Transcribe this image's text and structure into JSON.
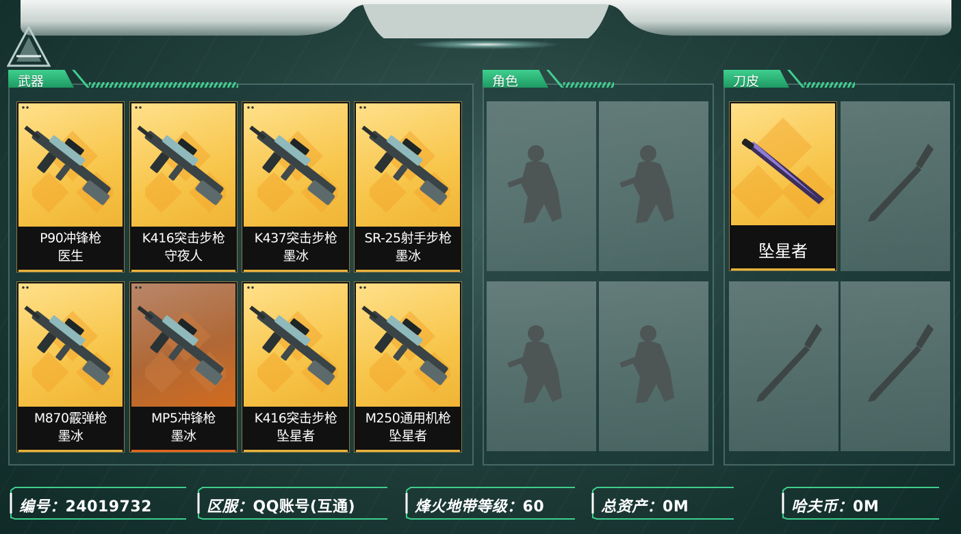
{
  "sections": {
    "weapons": {
      "title": "武器"
    },
    "characters": {
      "title": "角色"
    },
    "knife_skins": {
      "title": "刀皮"
    }
  },
  "weapons": [
    {
      "line1": "P90冲锋枪",
      "line2": "医生",
      "rarity": "gold"
    },
    {
      "line1": "K416突击步枪",
      "line2": "守夜人",
      "rarity": "gold"
    },
    {
      "line1": "K437突击步枪",
      "line2": "墨冰",
      "rarity": "gold"
    },
    {
      "line1": "SR-25射手步枪",
      "line2": "墨冰",
      "rarity": "gold"
    },
    {
      "line1": "M870霰弹枪",
      "line2": "墨冰",
      "rarity": "gold"
    },
    {
      "line1": "MP5冲锋枪",
      "line2": "墨冰",
      "rarity": "orange"
    },
    {
      "line1": "K416突击步枪",
      "line2": "坠星者",
      "rarity": "gold"
    },
    {
      "line1": "M250通用机枪",
      "line2": "坠星者",
      "rarity": "gold"
    }
  ],
  "knife_skins": [
    {
      "name": "坠星者"
    }
  ],
  "footer": {
    "id": {
      "label": "编号：",
      "value": "24019732"
    },
    "server": {
      "label": "区服：",
      "value": "QQ账号(互通)"
    },
    "level": {
      "label": "烽火地带等级：",
      "value": "60"
    },
    "assets": {
      "label": "总资产：",
      "value": "0M"
    },
    "coins": {
      "label": "哈夫币：",
      "value": "0M"
    }
  },
  "colors": {
    "accent_green": "#3fcf8e",
    "gold_card": "#f7c54a",
    "orange_card": "#d26b1e"
  }
}
